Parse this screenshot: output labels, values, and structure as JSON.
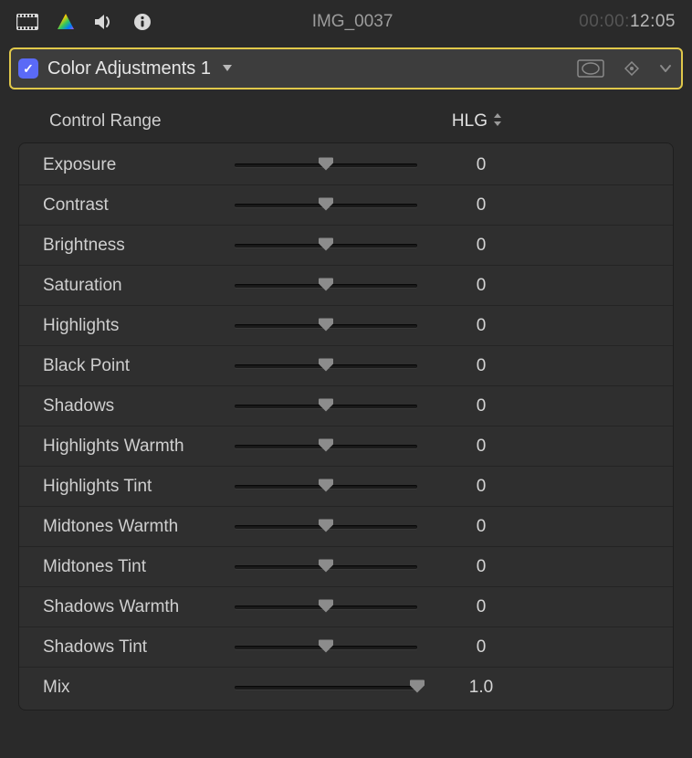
{
  "header": {
    "title": "IMG_0037",
    "timecode_dim": "00:00:",
    "timecode_active": "12:05"
  },
  "effect": {
    "enabled_icon": "✓",
    "title": "Color Adjustments 1"
  },
  "control_range": {
    "label": "Control Range",
    "value": "HLG"
  },
  "params": [
    {
      "label": "Exposure",
      "value": "0",
      "pos": 50
    },
    {
      "label": "Contrast",
      "value": "0",
      "pos": 50
    },
    {
      "label": "Brightness",
      "value": "0",
      "pos": 50
    },
    {
      "label": "Saturation",
      "value": "0",
      "pos": 50
    },
    {
      "label": "Highlights",
      "value": "0",
      "pos": 50
    },
    {
      "label": "Black Point",
      "value": "0",
      "pos": 50
    },
    {
      "label": "Shadows",
      "value": "0",
      "pos": 50
    },
    {
      "label": "Highlights Warmth",
      "value": "0",
      "pos": 50
    },
    {
      "label": "Highlights Tint",
      "value": "0",
      "pos": 50
    },
    {
      "label": "Midtones Warmth",
      "value": "0",
      "pos": 50
    },
    {
      "label": "Midtones Tint",
      "value": "0",
      "pos": 50
    },
    {
      "label": "Shadows Warmth",
      "value": "0",
      "pos": 50
    },
    {
      "label": "Shadows Tint",
      "value": "0",
      "pos": 50
    },
    {
      "label": "Mix",
      "value": "1.0",
      "pos": 100
    }
  ]
}
